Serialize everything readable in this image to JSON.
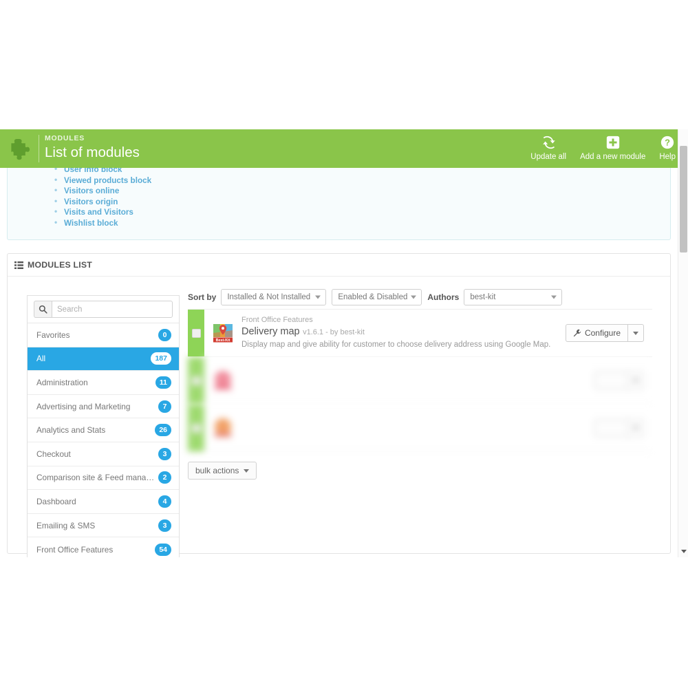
{
  "header": {
    "kicker": "MODULES",
    "title": "List of modules",
    "icon": "puzzle-piece-icon",
    "accent_color": "#8ac54a",
    "actions": [
      {
        "label": "Update all",
        "icon": "refresh-icon"
      },
      {
        "label": "Add a new module",
        "icon": "plus-square-icon"
      },
      {
        "label": "Help",
        "icon": "question-circle-icon"
      }
    ]
  },
  "info_panel": {
    "links": [
      "User info block",
      "Viewed products block",
      "Visitors online",
      "Visitors origin",
      "Visits and Visitors",
      "Wishlist block"
    ]
  },
  "modules_panel": {
    "title": "MODULES LIST",
    "title_icon": "list-icon"
  },
  "search": {
    "placeholder": "Search",
    "value": "",
    "icon": "search-icon"
  },
  "categories": [
    {
      "label": "Favorites",
      "count": "0",
      "active": false
    },
    {
      "label": "All",
      "count": "187",
      "active": true
    },
    {
      "label": "Administration",
      "count": "11",
      "active": false
    },
    {
      "label": "Advertising and Marketing",
      "count": "7",
      "active": false
    },
    {
      "label": "Analytics and Stats",
      "count": "26",
      "active": false
    },
    {
      "label": "Checkout",
      "count": "3",
      "active": false
    },
    {
      "label": "Comparison site & Feed manage...",
      "count": "2",
      "active": false
    },
    {
      "label": "Dashboard",
      "count": "4",
      "active": false
    },
    {
      "label": "Emailing & SMS",
      "count": "3",
      "active": false
    },
    {
      "label": "Front Office Features",
      "count": "54",
      "active": false
    }
  ],
  "filters": {
    "sort_by_label": "Sort by",
    "installed_value": "Installed & Not Installed",
    "enabled_value": "Enabled & Disabled",
    "authors_label": "Authors",
    "authors_value": "best-kit"
  },
  "modules": [
    {
      "category": "Front Office Features",
      "name": "Delivery map",
      "version": "v1.6.1 - by best-kit",
      "description": "Display map and give ability for customer to choose delivery address using Google Map.",
      "configure_label": "Configure",
      "configure_icon": "wrench-icon",
      "status_color": "#8ed457",
      "icon": "delivery-map-module-icon"
    }
  ],
  "bulk": {
    "label": "bulk actions"
  },
  "colors": {
    "header_green": "#8ac54a",
    "active_blue": "#29a7e4",
    "badge_blue": "#29a7e4",
    "link_blue": "#5aacd6",
    "status_green": "#8ed457"
  }
}
